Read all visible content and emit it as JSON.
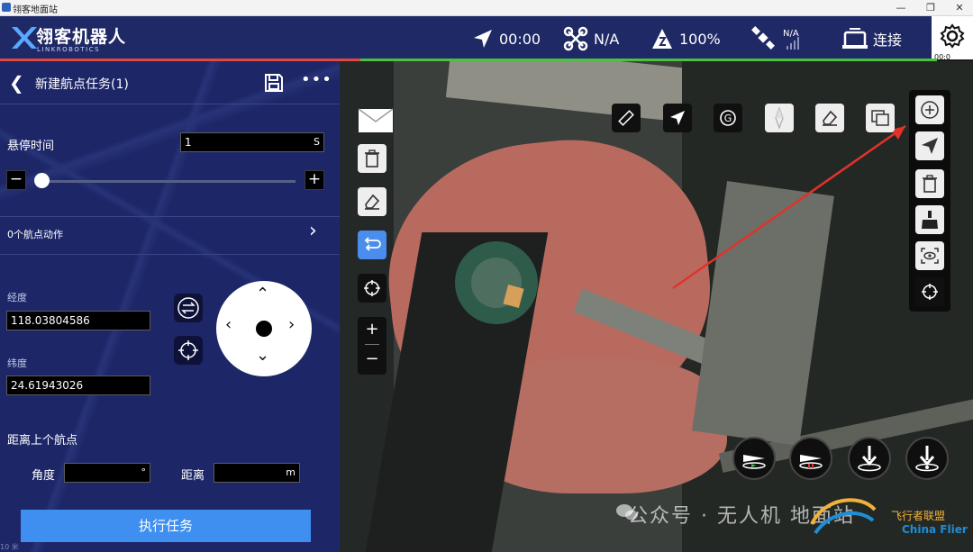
{
  "window": {
    "title": "翎客地面站",
    "controls": [
      "—",
      "❐",
      "✕"
    ]
  },
  "header": {
    "brand_name": "翎客机器人",
    "brand_sub": "LINKROBOTICS",
    "status": {
      "flight_time": "00:00",
      "drone_mode": "N/A",
      "battery": "100%",
      "gps_small": "N/A",
      "connection": "连接"
    },
    "settings_tiny": "00:0"
  },
  "panel": {
    "title": "新建航点任务(1)",
    "hover_time_label": "悬停时间",
    "hover_time_value": "1",
    "hover_time_unit": "S",
    "slider_minus": "−",
    "slider_plus": "+",
    "waypoint_actions": "0个航点动作",
    "longitude_label": "经度",
    "longitude_value": "118.03804586",
    "latitude_label": "纬度",
    "latitude_value": "24.61943026",
    "distance_label": "距离上个航点",
    "angle_label": "角度",
    "angle_unit": "°",
    "distance_short_label": "距离",
    "distance_unit": "m",
    "execute_label": "执行任务",
    "bottom_tiny": "10 米"
  },
  "map": {
    "zoom_in": "+",
    "zoom_out": "−",
    "watermark": "公众号 · 无人机 地面站",
    "brand_overlay": "飞行者联盟",
    "brand_overlay_en": "China Flier"
  }
}
